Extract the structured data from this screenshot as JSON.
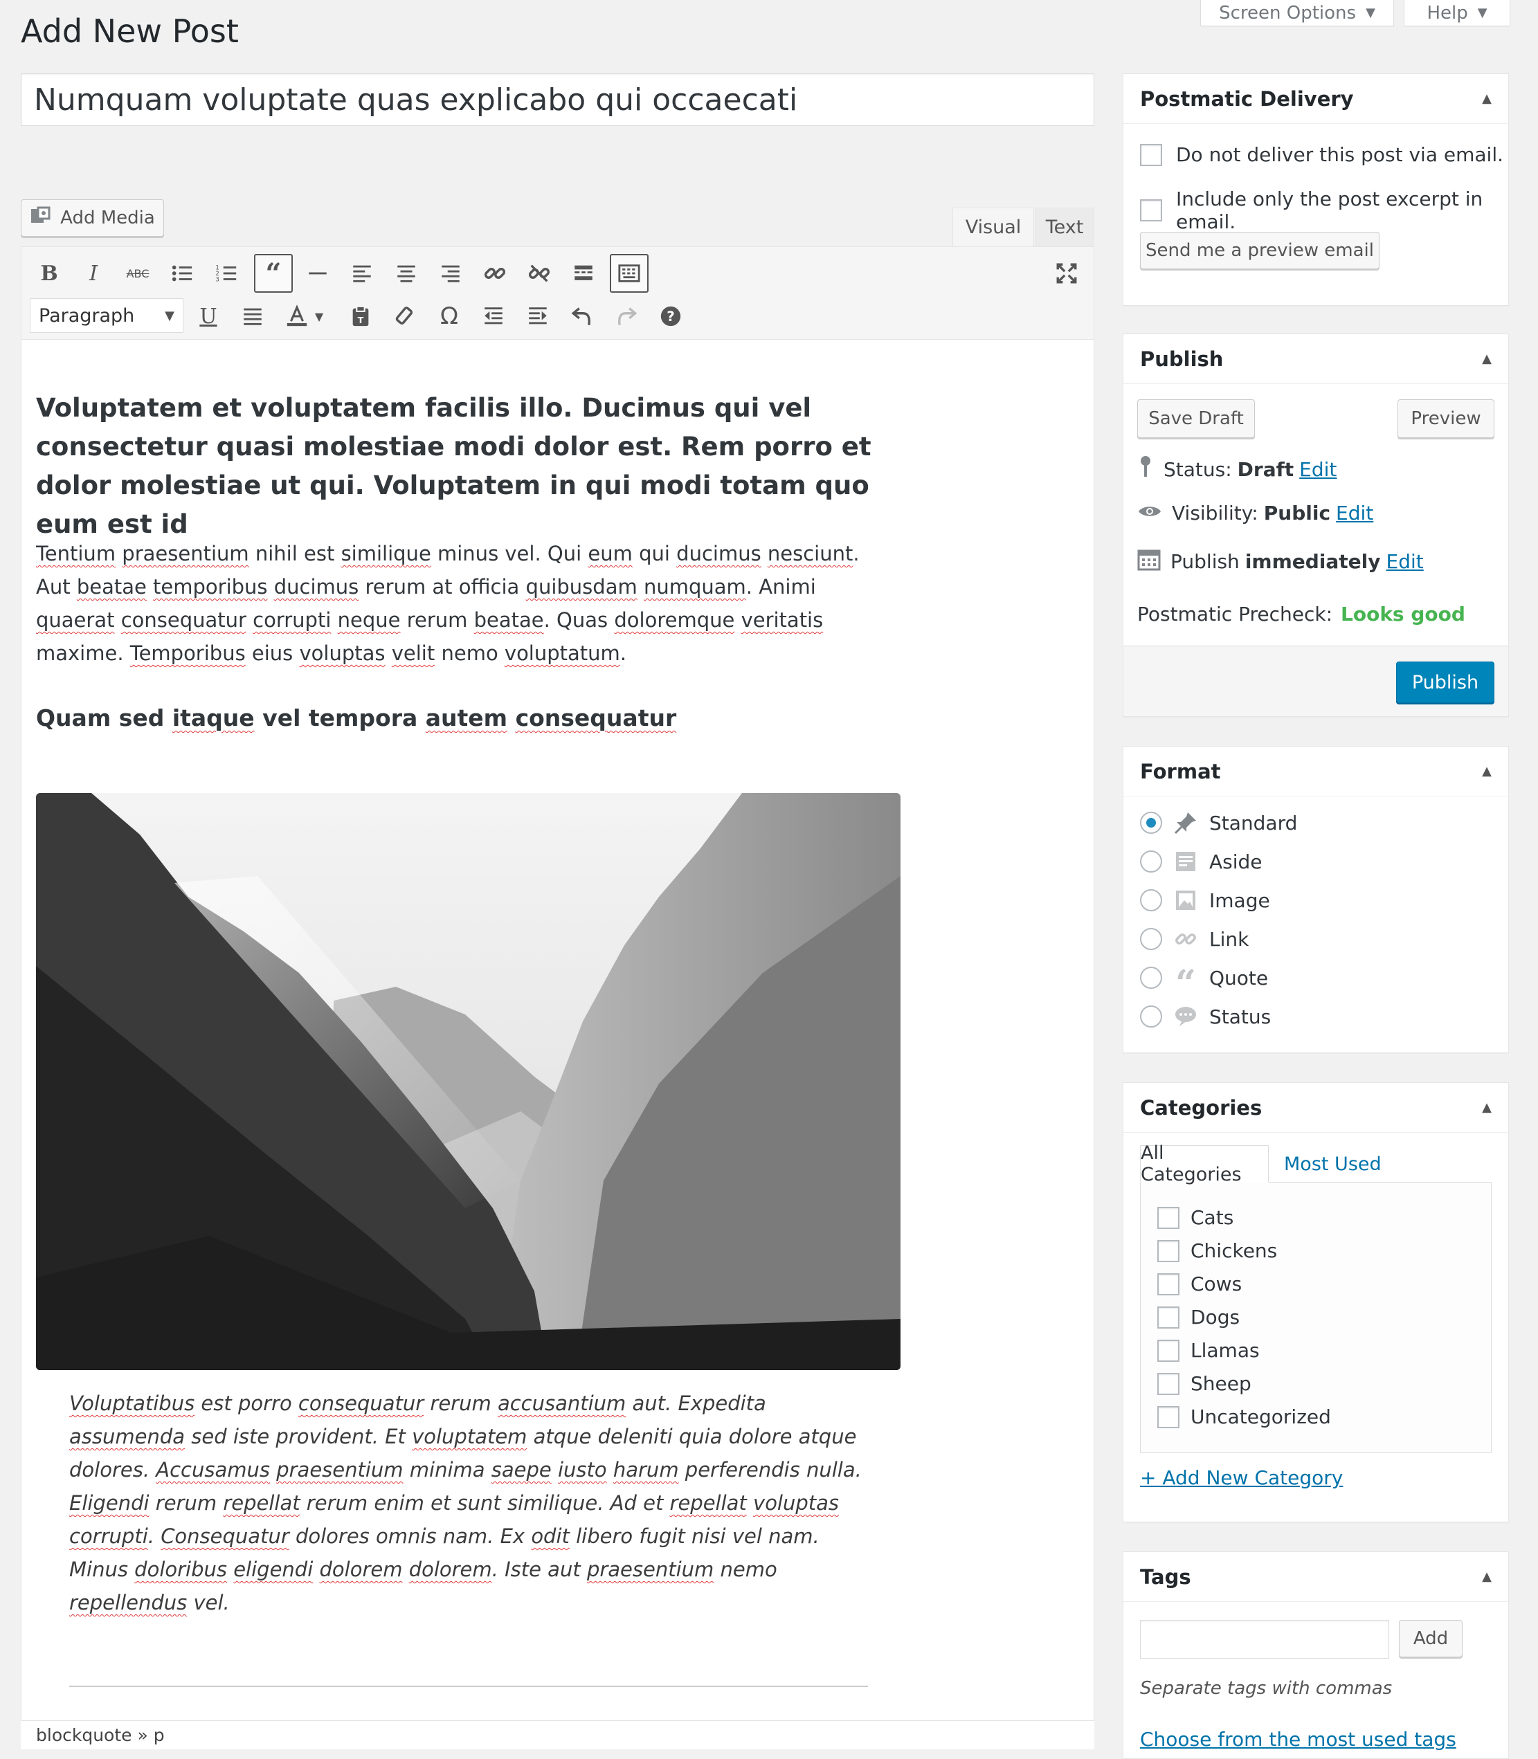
{
  "screen_meta": {
    "screen_options": "Screen Options",
    "help": "Help"
  },
  "page_title": "Add New Post",
  "post_title": "Numquam voluptate quas explicabo qui occaecati",
  "media": {
    "add_media": "Add Media"
  },
  "editor_tabs": {
    "visual": "Visual",
    "text": "Text"
  },
  "toolbar": {
    "format_select": "Paragraph",
    "row1_icons": [
      "bold-icon",
      "italic-icon",
      "strikethrough-icon",
      "bullet-list-icon",
      "numbered-list-icon",
      "blockquote-icon",
      "horizontal-rule-icon",
      "align-left-icon",
      "align-center-icon",
      "align-right-icon",
      "insert-link-icon",
      "remove-link-icon",
      "read-more-icon",
      "toolbar-toggle-icon",
      "fullscreen-icon"
    ],
    "row2_icons": [
      "underline-icon",
      "justify-icon",
      "text-color-icon",
      "paste-text-icon",
      "clear-formatting-icon",
      "special-character-icon",
      "outdent-icon",
      "indent-icon",
      "undo-icon",
      "redo-icon",
      "help-icon"
    ]
  },
  "content": {
    "heading": "Voluptatem et voluptatem facilis illo. Ducimus qui vel consectetur quasi molestiae modi dolor est. Rem porro et dolor molestiae ut qui. Voluptatem in qui modi totam quo eum est id",
    "paragraph": "Tentium praesentium nihil est similique minus vel. Qui eum qui ducimus nesciunt. Aut beatae temporibus ducimus rerum at officia quibusdam numquam. Animi quaerat consequatur corrupti neque rerum beatae. Quas doloremque veritatis maxime. Temporibus eius voluptas velit nemo voluptatum.",
    "subheading": "Quam sed itaque vel tempora autem consequatur",
    "image_alt": "black and white mountain valley photograph",
    "blockquote": "Voluptatibus est porro consequatur rerum accusantium aut. Expedita assumenda sed iste provident. Et voluptatem atque deleniti quia dolore atque dolores. Accusamus praesentium minima saepe iusto harum perferendis nulla. Eligendi rerum repellat rerum enim et sunt similique. Ad et repellat voluptas corrupti. Consequatur dolores omnis nam. Ex odit libero fugit nisi vel nam. Minus doloribus eligendi dolorem dolorem. Iste aut praesentium nemo repellendus vel."
  },
  "path_bar": "blockquote » p",
  "postmatic": {
    "title": "Postmatic Delivery",
    "no_deliver": "Do not deliver this post via email.",
    "excerpt_only": "Include only the post excerpt in email.",
    "preview_email": "Send me a preview email"
  },
  "publish": {
    "title": "Publish",
    "save_draft": "Save Draft",
    "preview": "Preview",
    "status_label": "Status:",
    "status_value": "Draft",
    "visibility_label": "Visibility:",
    "visibility_value": "Public",
    "publish_label": "Publish",
    "publish_value": "immediately",
    "edit": "Edit",
    "precheck_label": "Postmatic Precheck:",
    "precheck_value": "Looks good",
    "publish_button": "Publish"
  },
  "format": {
    "title": "Format",
    "selected": "Standard",
    "options": [
      {
        "label": "Standard",
        "icon": "pin-icon"
      },
      {
        "label": "Aside",
        "icon": "aside-icon"
      },
      {
        "label": "Image",
        "icon": "image-icon"
      },
      {
        "label": "Link",
        "icon": "link-icon"
      },
      {
        "label": "Quote",
        "icon": "quote-icon"
      },
      {
        "label": "Status",
        "icon": "status-icon"
      }
    ]
  },
  "categories": {
    "title": "Categories",
    "tab_all": "All Categories",
    "tab_most_used": "Most Used",
    "items": [
      "Cats",
      "Chickens",
      "Cows",
      "Dogs",
      "Llamas",
      "Sheep",
      "Uncategorized"
    ],
    "add_new": "+ Add New Category"
  },
  "tags": {
    "title": "Tags",
    "add": "Add",
    "hint": "Separate tags with commas",
    "choose": "Choose from the most used tags"
  },
  "colors": {
    "link": "#0073aa",
    "primary": "#0085ba",
    "success": "#46b450",
    "spell": "#e13a3a"
  }
}
